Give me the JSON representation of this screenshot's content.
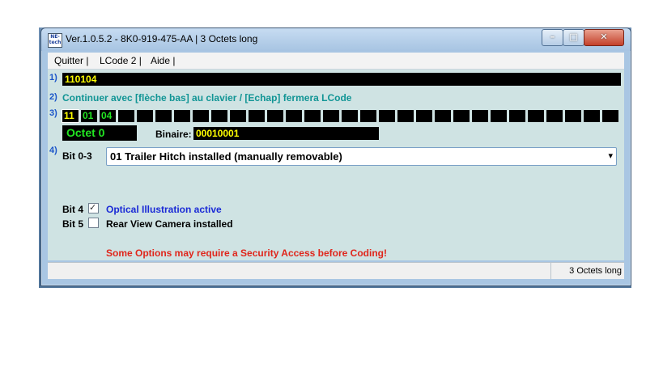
{
  "window": {
    "title": "Ver.1.0.5.2 -   8K0-919-475-AA | 3 Octets long",
    "app_icon": "NEtech-app-icon",
    "app_icon_text": "NE-tech",
    "minimize_glyph": "–",
    "maximize_glyph": "□",
    "close_glyph": "✕"
  },
  "menu": {
    "items": [
      {
        "label": "Quitter |"
      },
      {
        "label": "LCode 2 |"
      },
      {
        "label": "Aide |"
      }
    ]
  },
  "step1": {
    "num": "1)",
    "code": "110104"
  },
  "step2": {
    "num": "2)",
    "hint": "Continuer avec [flèche bas] au clavier / [Echap] fermera LCode"
  },
  "step3": {
    "num": "3)",
    "bytes": [
      "11",
      "01",
      "04"
    ],
    "empty_cells": 27,
    "selected_index": 0,
    "octet_label": "Octet 0",
    "binaire_label": "Binaire:",
    "binaire_value": "00010001"
  },
  "step4": {
    "num": "4)",
    "bit03_label": "Bit 0-3",
    "bit03_value": "01 Trailer Hitch installed (manually removable)",
    "dropdown_icon": "▾",
    "bits": [
      {
        "label": "Bit 4",
        "checked": true,
        "text": "Optical Illustration active",
        "text_color": "#1a2ad6"
      },
      {
        "label": "Bit 5",
        "checked": false,
        "text": "Rear View Camera installed",
        "text_color": "#000000"
      }
    ],
    "warning": "Some Options may require a Security Access before Coding!",
    "warning_color": "#e0261b"
  },
  "status": {
    "right_text": "3 Octets long"
  },
  "colors": {
    "accent_green": "#22e522",
    "code_yellow": "#ffff00",
    "hint_teal": "#119595",
    "client_bg": "#cfe3e3"
  }
}
